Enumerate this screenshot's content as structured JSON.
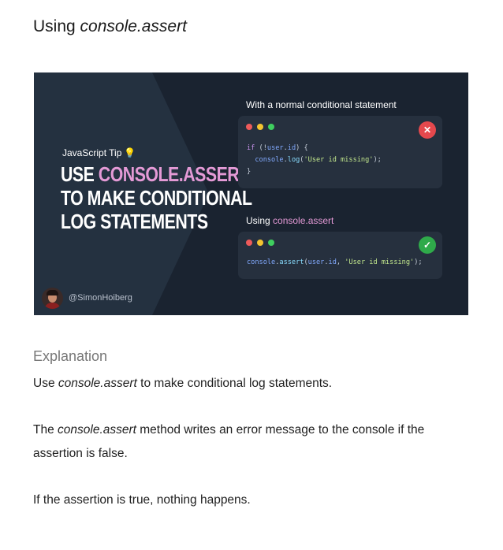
{
  "title": {
    "prefix": "Using ",
    "code": "console.assert"
  },
  "banner": {
    "tip_label": "JavaScript Tip",
    "tip_icon": "lightbulb-icon",
    "headline": {
      "line1_prefix": "USE ",
      "line1_accent": "CONSOLE.ASSERT",
      "line2": "TO MAKE CONDITIONAL",
      "line3": "LOG STATEMENTS"
    },
    "author_handle": "@SimonHoiberg",
    "example_bad": {
      "label": "With a normal conditional statement",
      "status_icon": "cross-icon",
      "status_glyph": "✕",
      "code": {
        "l1_kw": "if",
        "l1_open": " (!",
        "l1_obj": "user",
        "l1_dot": ".",
        "l1_prop": "id",
        "l1_close": ") {",
        "l2_indent": "  ",
        "l2_obj": "console",
        "l2_dot": ".",
        "l2_fn": "log",
        "l2_open": "(",
        "l2_str": "'User id missing'",
        "l2_close": ");",
        "l3": "}"
      }
    },
    "example_good": {
      "label_prefix": "Using ",
      "label_accent": "console.assert",
      "status_icon": "check-icon",
      "status_glyph": "✓",
      "code": {
        "obj": "console",
        "dot": ".",
        "fn": "assert",
        "open": "(",
        "arg_obj": "user",
        "arg_dot": ".",
        "arg_prop": "id",
        "comma": ", ",
        "str": "'User id missing'",
        "close": ");"
      }
    },
    "colors": {
      "background": "#1a2330",
      "panel": "#26303e",
      "accent_pink": "#e49ad6",
      "error_red": "#e5484d",
      "success_green": "#2faa4a"
    }
  },
  "explanation": {
    "heading": "Explanation",
    "p1": {
      "before": "Use ",
      "code": "console.assert",
      "after": " to make conditional log statements."
    },
    "p2": {
      "before": "The ",
      "code": "console.assert",
      "after": " method writes an error message to the console if the assertion is false."
    },
    "p3": "If the assertion is true, nothing happens."
  }
}
